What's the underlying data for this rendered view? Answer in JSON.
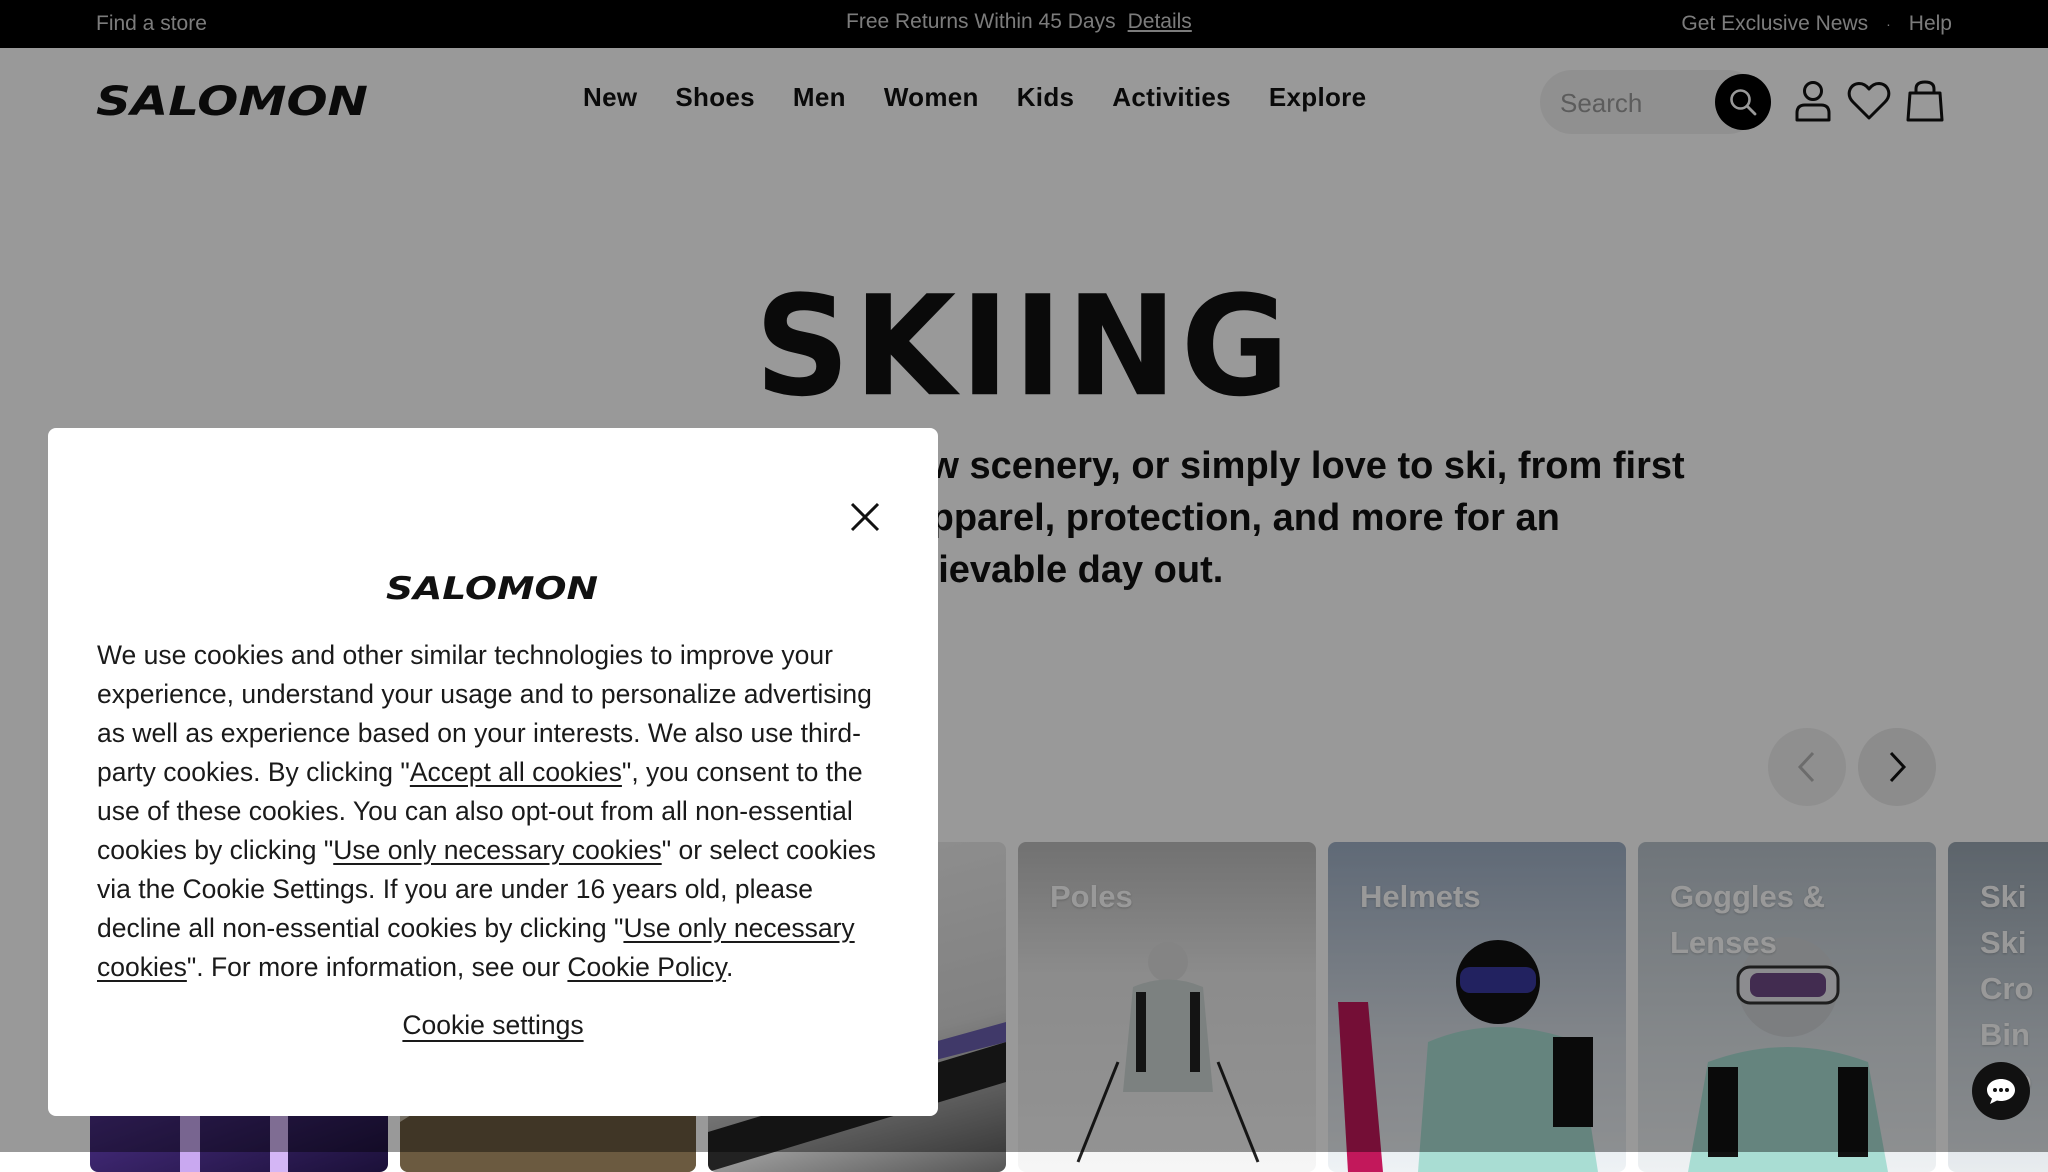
{
  "topbar": {
    "store": "Find a store",
    "promo": "Free Returns Within 45 Days",
    "promo_link": "Details",
    "news": "Get Exclusive News",
    "separator": "·",
    "help": "Help"
  },
  "brand": {
    "logo_text": "SALOMON"
  },
  "nav": {
    "items": [
      "New",
      "Shoes",
      "Men",
      "Women",
      "Kids",
      "Activities",
      "Explore"
    ]
  },
  "search": {
    "placeholder": "Search"
  },
  "icons": {
    "search": "search-icon",
    "account": "user-icon",
    "wishlist": "heart-icon",
    "bag": "shopping-bag-icon",
    "prev": "chevron-left-icon",
    "next": "chevron-right-icon",
    "close": "close-icon",
    "chat": "chat-bubble-icon"
  },
  "hero": {
    "title": "SKIING",
    "subtitle_lines": [
      "out new scenery, or simply love to ski, from first",
      "gear, apparel, protection, and more for an",
      "hievable day out."
    ]
  },
  "categories": [
    {
      "label": ""
    },
    {
      "label": ""
    },
    {
      "label": ""
    },
    {
      "label": "Poles"
    },
    {
      "label": "Helmets"
    },
    {
      "label": "Goggles & Lenses"
    },
    {
      "label": "Ski Ski Cro Bin Pro"
    }
  ],
  "cookie": {
    "t1": "We use cookies and other similar technologies to improve your experience, understand your usage and to personalize advertising as well as experience based on your interests. We also use third-party cookies. By clicking \"",
    "accept_link": "Accept all cookies",
    "t2": "\", you consent to the use of these cookies. You can also opt-out from all non-essential cookies by clicking \"",
    "necessary_link_1": "Use only necessary cookies",
    "t3": "\" or select cookies via the Cookie Settings. If you are under 16 years old, please decline all non-essential cookies by clicking \"",
    "necessary_link_2": "Use only necessary cookies",
    "t4": "\". For more information, see our ",
    "policy_link": "Cookie Policy",
    "t5": ".",
    "settings_label": "Cookie settings"
  },
  "colors": {
    "topbar_bg": "#000000",
    "overlay": "rgba(0,0,0,0.40)",
    "text": "#111111"
  }
}
